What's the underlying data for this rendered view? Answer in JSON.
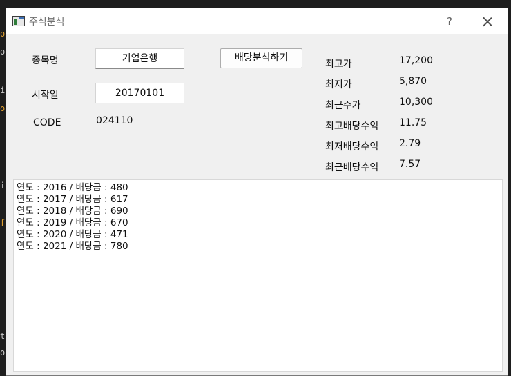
{
  "window": {
    "title": "주식분석",
    "help_label": "?"
  },
  "form": {
    "stock_name_label": "종목명",
    "stock_name_value": "기업은행",
    "start_date_label": "시작일",
    "start_date_value": "20170101",
    "code_label": "CODE",
    "code_value": "024110",
    "analyze_button_label": "배당분석하기"
  },
  "stats": [
    {
      "label": "최고가",
      "value": "17,200"
    },
    {
      "label": "최저가",
      "value": "5,870"
    },
    {
      "label": "최근주가",
      "value": "10,300"
    },
    {
      "label": "최고배당수익",
      "value": "11.75"
    },
    {
      "label": "최저배당수익",
      "value": "2.79"
    },
    {
      "label": "최근배당수익",
      "value": "7.57"
    }
  ],
  "output_lines": [
    "연도 : 2016 / 배당금 : 480",
    "연도 : 2017 / 배당금 : 617",
    "연도 : 2018 / 배당금 : 690",
    "연도 : 2019 / 배당금 : 670",
    "연도 : 2020 / 배당금 : 471",
    "연도 : 2021 / 배당금 : 780"
  ]
}
